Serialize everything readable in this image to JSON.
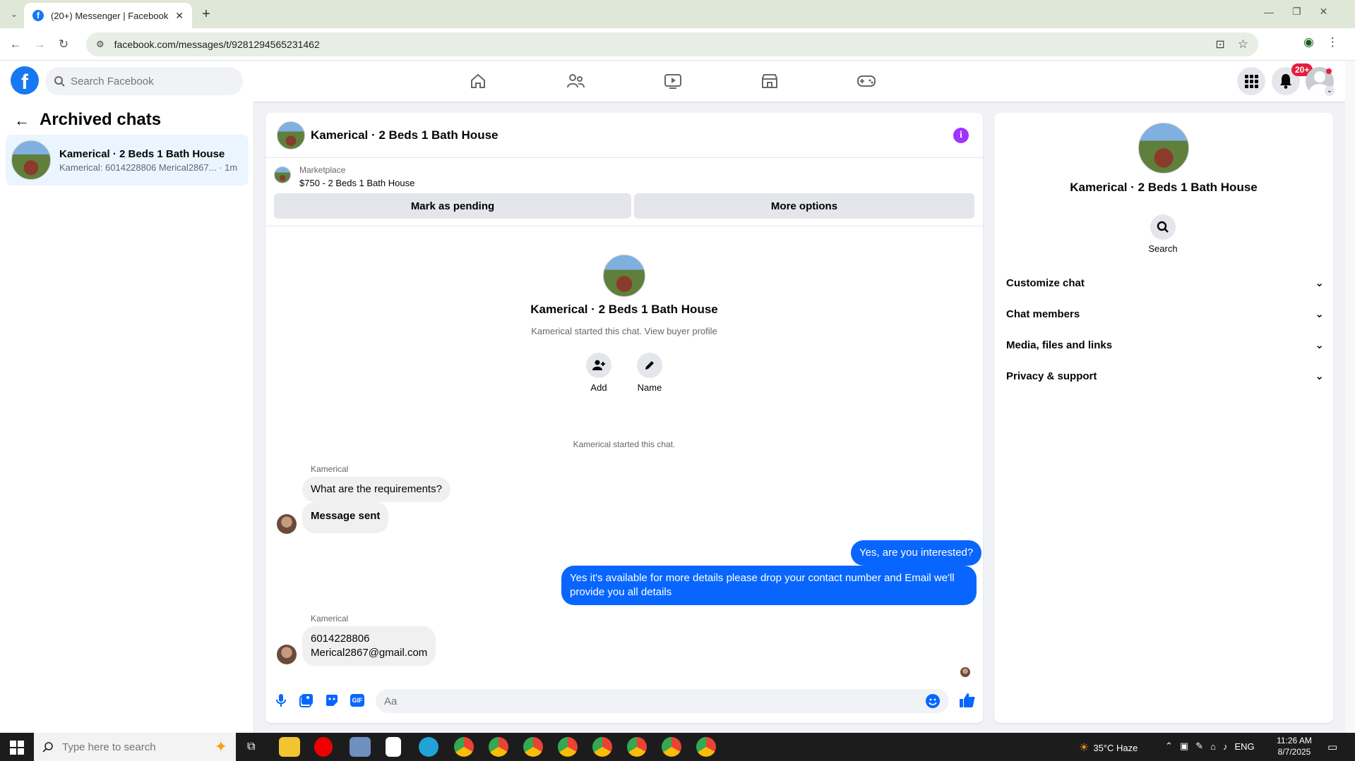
{
  "browser": {
    "tab_title": "(20+) Messenger | Facebook",
    "tab_close": "✕",
    "new_tab": "+",
    "url": "facebook.com/messages/t/9281294565231462"
  },
  "fb": {
    "logo_letter": "f",
    "search_placeholder": "Search Facebook",
    "notification_badge": "20+"
  },
  "sidebar": {
    "title": "Archived chats",
    "chats": [
      {
        "name": "Kamerical · 2 Beds 1 Bath House",
        "preview": "Kamerical: 6014228806 Merical2867...",
        "time": "· 1m"
      }
    ]
  },
  "conversation": {
    "title": "Kamerical · 2 Beds 1 Bath House",
    "info_glyph": "i",
    "marketplace_label": "Marketplace",
    "listing": "$750 - 2 Beds 1 Bath House",
    "mark_pending": "Mark as pending",
    "more_options": "More options",
    "intro_title": "Kamerical · 2 Beds 1 Bath House",
    "intro_sub": "Kamerical started this chat. View buyer profile",
    "add_label": "Add",
    "name_label": "Name",
    "started_note": "Kamerical started this chat.",
    "messages": [
      {
        "sender": "Kamerical",
        "text": "What are the requirements?"
      },
      {
        "text": "Message sent"
      },
      {
        "text": "Yes, are you interested?"
      },
      {
        "text": "Yes it's available for more details please drop your contact number and Email we'll provide you all details"
      },
      {
        "sender": "Kamerical",
        "line1": "6014228806",
        "line2": "Merical2867@gmail.com"
      }
    ],
    "composer_placeholder": "Aa",
    "gif_label": "GIF"
  },
  "details": {
    "title": "Kamerical · 2 Beds 1 Bath House",
    "search_label": "Search",
    "sections": [
      "Customize chat",
      "Chat members",
      "Media, files and links",
      "Privacy & support"
    ]
  },
  "taskbar": {
    "search_placeholder": "Type here to search",
    "weather": "35°C  Haze",
    "lang": "ENG",
    "time": "11:26 AM",
    "date": "8/7/2025"
  },
  "colors": {
    "accent": "#0866ff",
    "brand": "#1877f2",
    "info": "#a033ff",
    "badge": "#e41e3f"
  }
}
